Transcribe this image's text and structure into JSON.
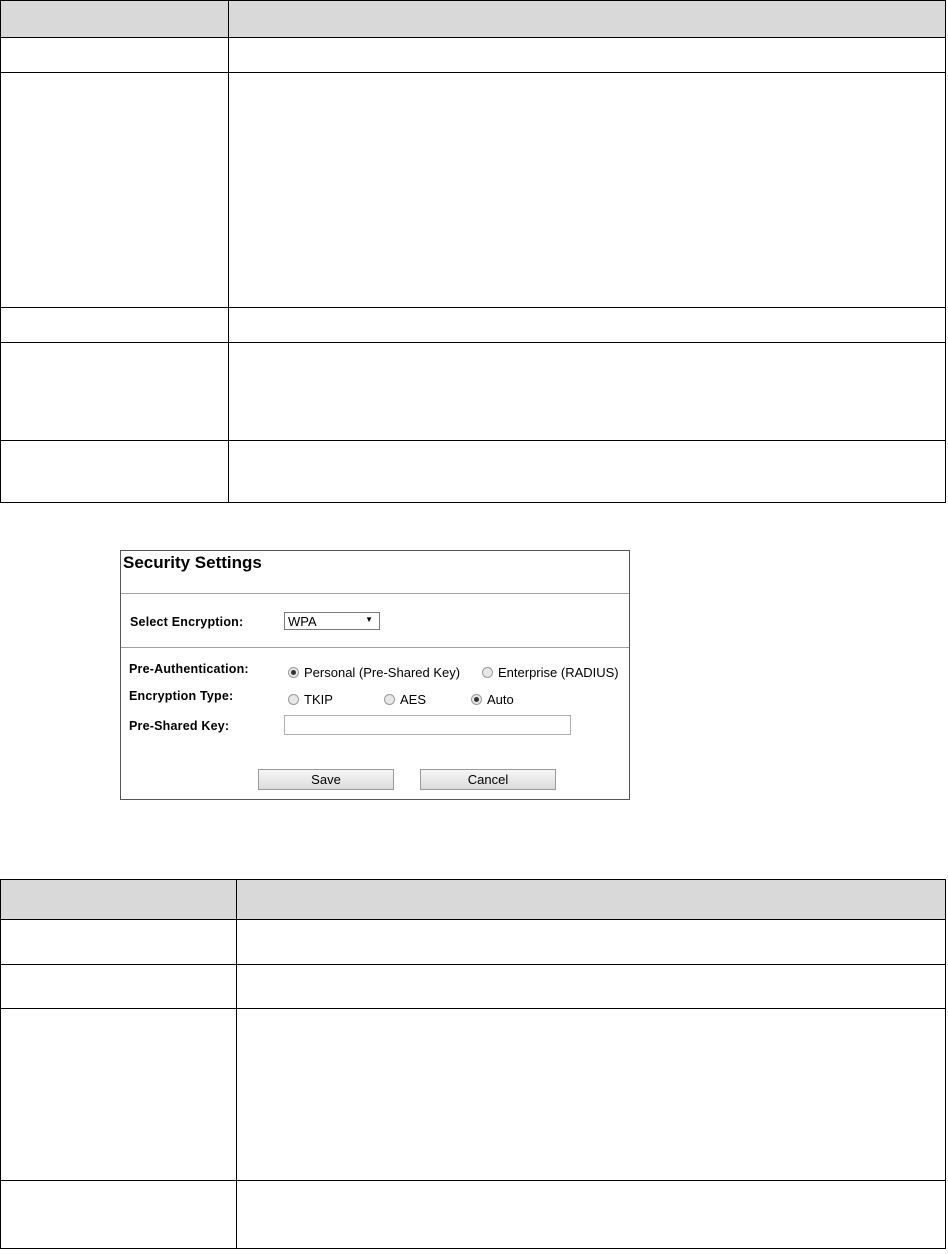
{
  "security_settings": {
    "title": "Security Settings",
    "select_encryption_label": "Select Encryption:",
    "encryption_selected": "WPA",
    "pre_authentication_label": "Pre-Authentication:",
    "pre_authentication_options": [
      {
        "label": "Personal (Pre-Shared Key)",
        "selected": true
      },
      {
        "label": "Enterprise (RADIUS)",
        "selected": false
      }
    ],
    "encryption_type_label": "Encryption Type:",
    "encryption_type_options": [
      {
        "label": "TKIP",
        "selected": false
      },
      {
        "label": "AES",
        "selected": false
      },
      {
        "label": "Auto",
        "selected": true
      }
    ],
    "pre_shared_key_label": "Pre-Shared Key:",
    "pre_shared_key_value": "",
    "save_label": "Save",
    "cancel_label": "Cancel"
  },
  "colors": {
    "table_header_bg": "#d9d9d9",
    "border": "#000000"
  }
}
